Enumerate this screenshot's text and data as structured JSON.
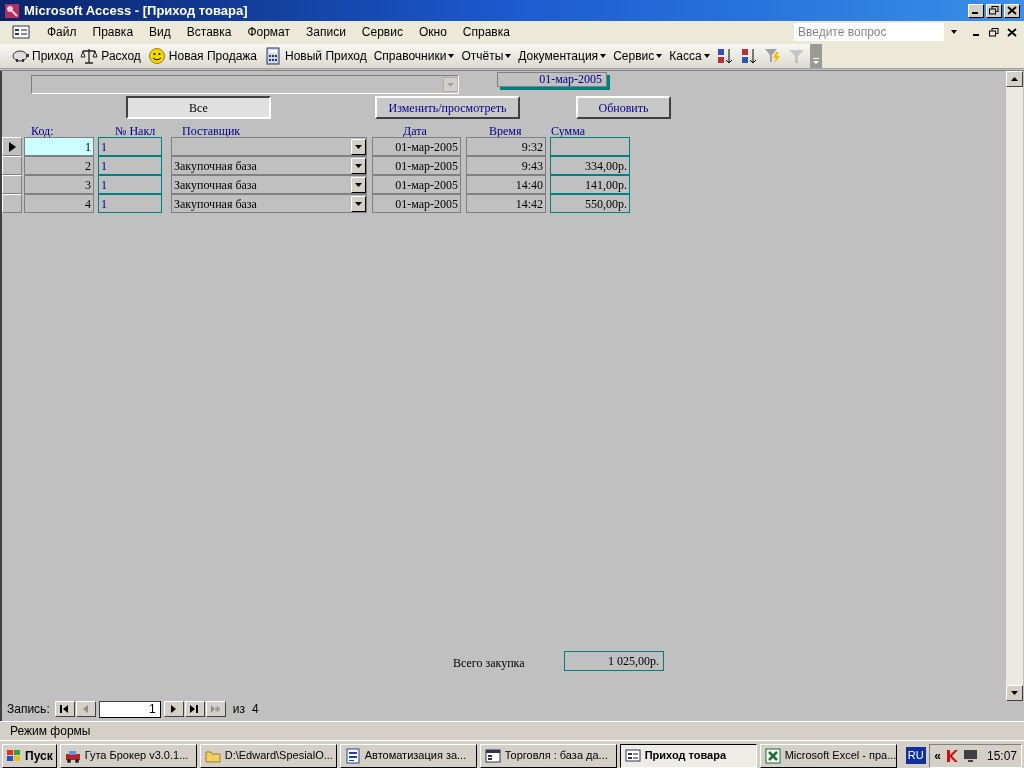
{
  "window": {
    "title": "Microsoft Access - [Приход товара]"
  },
  "menu": [
    "Файл",
    "Правка",
    "Вид",
    "Вставка",
    "Формат",
    "Записи",
    "Сервис",
    "Окно",
    "Справка"
  ],
  "help_search": {
    "placeholder": "Введите вопрос"
  },
  "toolbar": [
    {
      "kind": "button",
      "label": "Приход"
    },
    {
      "kind": "button",
      "label": "Расход"
    },
    {
      "kind": "button",
      "label": "Новая Продажа"
    },
    {
      "kind": "button",
      "label": "Новый Приход"
    },
    {
      "kind": "menu",
      "label": "Справочники"
    },
    {
      "kind": "menu",
      "label": "Отчёты"
    },
    {
      "kind": "menu",
      "label": "Документация"
    },
    {
      "kind": "menu",
      "label": "Сервис"
    },
    {
      "kind": "menu",
      "label": "Касса"
    },
    {
      "kind": "icon",
      "disabled": false
    },
    {
      "kind": "icon",
      "disabled": false
    },
    {
      "kind": "icon",
      "disabled": false
    },
    {
      "kind": "icon",
      "disabled": true
    }
  ],
  "form": {
    "date": "01-мар-2005",
    "buttons": [
      {
        "label": "Все",
        "pressed": true
      },
      {
        "label": "Изменить/просмотреть",
        "pressed": false
      },
      {
        "label": "Обновить",
        "pressed": false
      }
    ],
    "columns": [
      "Код:",
      "№ Накл",
      "Поставщик",
      "Дата",
      "Время",
      "Сумма"
    ],
    "rows": [
      {
        "selected": true,
        "code": "1",
        "invoice": "1",
        "date": "01-мар-2005",
        "time": "9:32"
      },
      {
        "selected": false,
        "code": "2",
        "invoice": "1",
        "supplier": "Закупочная база",
        "date": "01-мар-2005",
        "time": "9:43",
        "sum": "334,00р."
      },
      {
        "selected": false,
        "code": "3",
        "invoice": "1",
        "supplier": "Закупочная база",
        "date": "01-мар-2005",
        "time": "14:40",
        "sum": "141,00р."
      },
      {
        "selected": false,
        "code": "4",
        "invoice": "1",
        "supplier": "Закупочная база",
        "date": "01-мар-2005",
        "time": "14:42",
        "sum": "550,00р."
      }
    ],
    "total_label": "Всего закупка",
    "total": "1 025,00р."
  },
  "record_nav": {
    "label": "Запись:",
    "current": "1",
    "of": "из",
    "count": "4"
  },
  "status_bar": "Режим формы",
  "taskbar": {
    "start": "Пуск",
    "tasks": [
      {
        "label": "Гута Брокер v3.0.1...",
        "selected": false
      },
      {
        "label": "D:\\Edward\\SpesialO...",
        "selected": false
      },
      {
        "label": "Автоматизация за...",
        "selected": false
      },
      {
        "label": "Торговля : база да...",
        "selected": false
      },
      {
        "label": "Приход товара",
        "selected": true
      },
      {
        "label": "Microsoft Excel - пра...",
        "selected": false
      }
    ],
    "language": "RU",
    "tray_toggle": "«",
    "clock": "15:07"
  }
}
